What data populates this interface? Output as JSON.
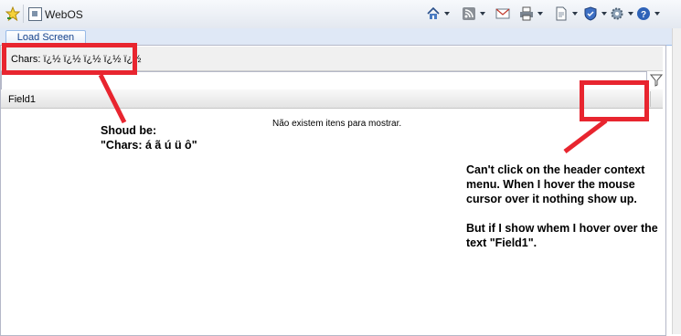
{
  "browser": {
    "tab_title": "WebOS",
    "icons": {
      "favorites": "favorites-star-icon",
      "home": "home-icon",
      "feeds": "rss-feed-icon",
      "mail": "mail-icon",
      "print": "print-icon",
      "page": "page-menu-icon",
      "safety": "safety-shield-icon",
      "tools": "tools-gear-icon",
      "help": "help-icon"
    }
  },
  "app": {
    "tab_label": "Load Screen",
    "chars_label": "Chars: ï¿½ ï¿½ ï¿½ ï¿½ ï¿½",
    "grid": {
      "column_header": "Field1",
      "empty_text": "Não existem itens para mostrar."
    }
  },
  "annotations": {
    "note1": [
      "Shoud be:",
      "\"Chars: á ã ú ü ô\""
    ],
    "note2": [
      "Can't click on the header context",
      "menu. When I hover the mouse",
      "cursor over it nothing show up.",
      "",
      "But if I show whem I hover over the",
      "text \"Field1\"."
    ],
    "color": "#e8252f"
  }
}
